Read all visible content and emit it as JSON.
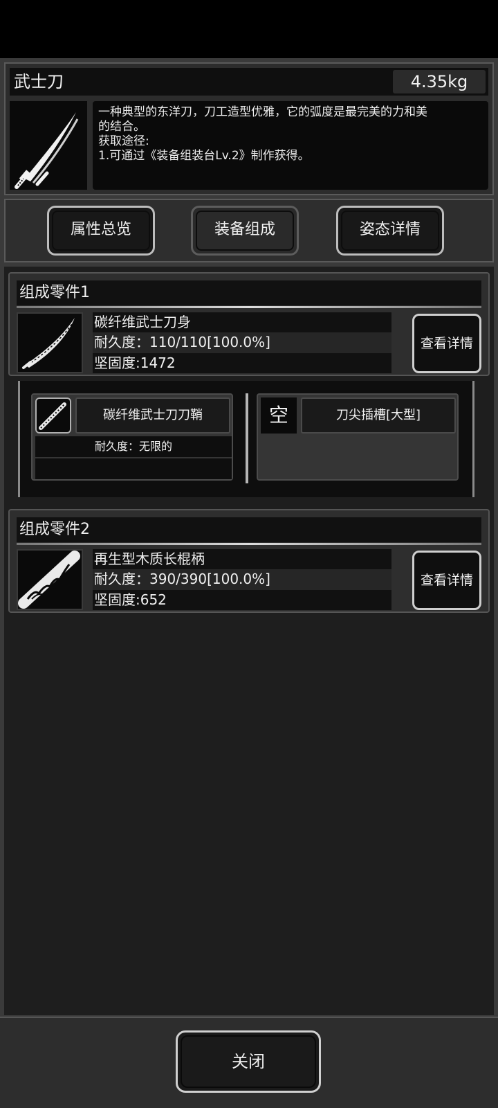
{
  "item": {
    "name": "武士刀",
    "weight": "4.35kg",
    "icon": "katana-icon",
    "description": [
      "一种典型的东洋刀，刀工造型优雅，它的弧度是最完美的力和美",
      "的结合。",
      "获取途径:",
      "1.可通过《装备组装台Lv.2》制作获得。"
    ]
  },
  "tabs": [
    {
      "label": "属性总览",
      "active": false
    },
    {
      "label": "装备组成",
      "active": true
    },
    {
      "label": "姿态详情",
      "active": false
    }
  ],
  "parts": [
    {
      "title": "组成零件1",
      "name": "碳纤维武士刀身",
      "durability": "耐久度：110/110[100.0%]",
      "hardness": "坚固度:1472",
      "detail_label": "查看详情",
      "icon": "blade-icon",
      "slots": [
        {
          "name": "碳纤维武士刀刀鞘",
          "line1": "耐久度：无限的",
          "line2": "",
          "icon": "scabbard-icon"
        },
        {
          "name": "刀尖插槽[大型]",
          "empty_label": "空"
        }
      ]
    },
    {
      "title": "组成零件2",
      "name": "再生型木质长棍柄",
      "durability": "耐久度：390/390[100.0%]",
      "hardness": "坚固度:652",
      "detail_label": "查看详情",
      "icon": "handle-icon"
    }
  ],
  "footer": {
    "close_label": "关闭"
  },
  "colors": {
    "background": "#1e1e1e",
    "frame": "#3a3a3a",
    "border_light": "#cfcfcf"
  }
}
